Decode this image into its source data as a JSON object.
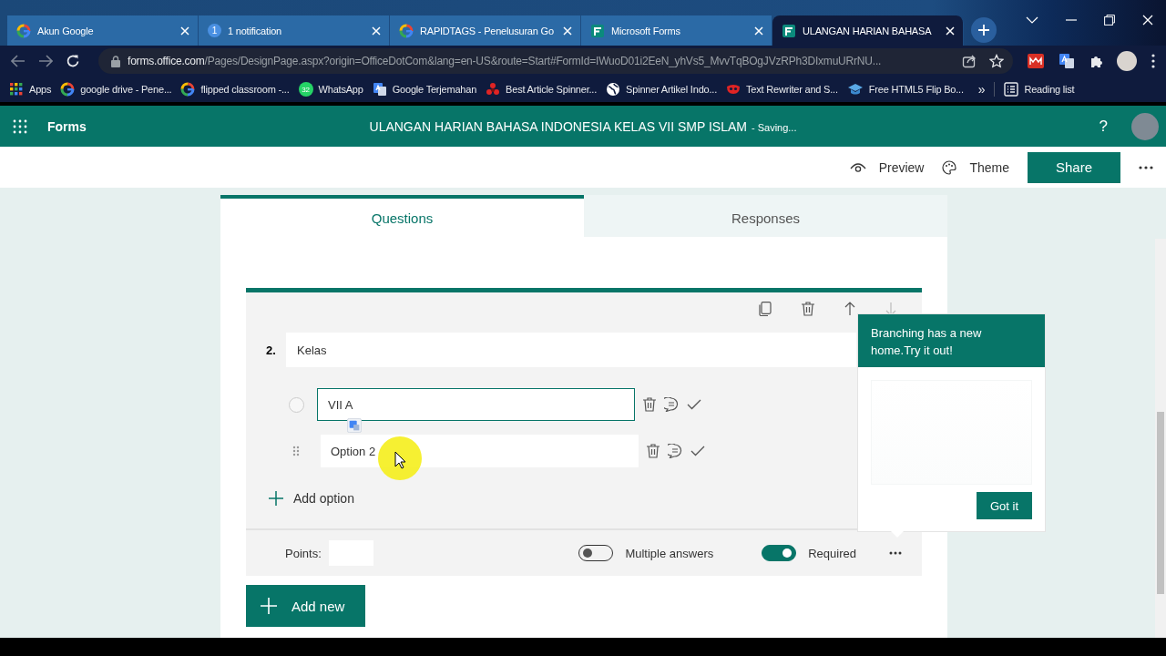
{
  "browser": {
    "tabs": [
      {
        "title": "Akun Google",
        "selected": false
      },
      {
        "title": "1 notification",
        "badge": "1",
        "selected": false
      },
      {
        "title": "RAPIDTAGS - Penelusuran Go",
        "selected": false
      },
      {
        "title": "Microsoft Forms",
        "selected": false
      },
      {
        "title": "ULANGAN HARIAN BAHASA",
        "selected": true
      }
    ],
    "url": {
      "host": "forms.office.com",
      "path": "/Pages/DesignPage.aspx?origin=OfficeDotCom&lang=en-US&route=Start#FormId=IWuoD01i2EeN_yhVs5_MvvTqBOgJVzRPh3DIxmuURrNU..."
    },
    "bookmarks": [
      {
        "label": "Apps"
      },
      {
        "label": "google drive - Pene..."
      },
      {
        "label": "flipped classroom -..."
      },
      {
        "label": "WhatsApp",
        "badge": "32"
      },
      {
        "label": "Google Terjemahan"
      },
      {
        "label": "Best Article Spinner..."
      },
      {
        "label": "Spinner Artikel Indo..."
      },
      {
        "label": "Text Rewriter and S..."
      },
      {
        "label": "Free HTML5 Flip Bo..."
      }
    ],
    "more": "»",
    "reading_list": "Reading list"
  },
  "app": {
    "name": "Forms",
    "title": "ULANGAN HARIAN BAHASA INDONESIA KELAS VII SMP ISLAM",
    "save_status": "- Saving...",
    "help": "?"
  },
  "commands": [
    {
      "label": "Preview"
    },
    {
      "label": "Theme"
    }
  ],
  "share": "Share",
  "view_tabs": [
    {
      "label": "Questions",
      "selected": true
    },
    {
      "label": "Responses",
      "selected": false
    }
  ],
  "question": {
    "number": "2.",
    "title": "Kelas",
    "options": [
      {
        "value": "VII A",
        "focused": true,
        "selected": false
      },
      {
        "value": "Option 2",
        "focused": false,
        "selected": false
      }
    ],
    "add_option": "Add option",
    "points_label": "Points:",
    "toggles": [
      {
        "label": "Multiple answers",
        "on": false
      },
      {
        "label": "Required",
        "on": true
      }
    ]
  },
  "add_new": "Add new",
  "callout": {
    "text": "Branching has a new home.Try it out!",
    "button": "Got it"
  }
}
